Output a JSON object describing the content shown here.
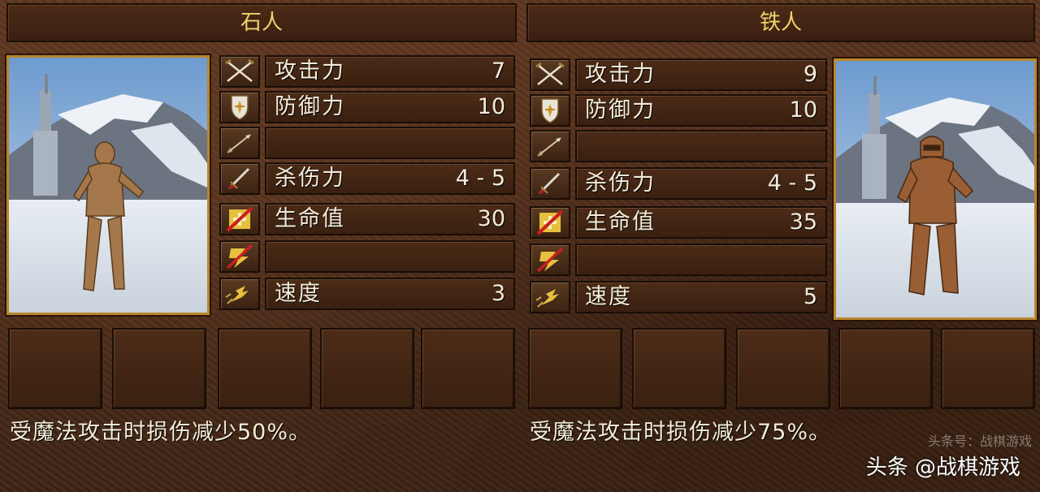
{
  "units": [
    {
      "name": "石人",
      "stats": [
        {
          "icon": "crossed-swords-icon",
          "label": "攻击力",
          "value": "7"
        },
        {
          "icon": "shield-icon",
          "label": "防御力",
          "value": "10"
        },
        {
          "icon": "arrow-icon",
          "label": "",
          "value": ""
        },
        {
          "icon": "sword-icon",
          "label": "杀伤力",
          "value": "4 - 5"
        },
        {
          "icon": "health-icon",
          "label": "生命值",
          "value": "30"
        },
        {
          "icon": "mana-icon",
          "label": "",
          "value": ""
        },
        {
          "icon": "speed-icon",
          "label": "速度",
          "value": "3"
        }
      ],
      "description": "受魔法攻击时损伤减少50%。"
    },
    {
      "name": "铁人",
      "stats": [
        {
          "icon": "crossed-swords-icon",
          "label": "攻击力",
          "value": "9"
        },
        {
          "icon": "shield-icon",
          "label": "防御力",
          "value": "10"
        },
        {
          "icon": "arrow-icon",
          "label": "",
          "value": ""
        },
        {
          "icon": "sword-icon",
          "label": "杀伤力",
          "value": "4 - 5"
        },
        {
          "icon": "health-icon",
          "label": "生命值",
          "value": "35"
        },
        {
          "icon": "mana-icon",
          "label": "",
          "value": ""
        },
        {
          "icon": "speed-icon",
          "label": "速度",
          "value": "5"
        }
      ],
      "description": "受魔法攻击时损伤减少75%。"
    }
  ],
  "watermark": {
    "small": "头条号：战棋游戏",
    "large": "头条 @战棋游戏"
  },
  "colors": {
    "title_text": "#f2d26a",
    "body_text": "#f4ecd8",
    "portrait_frame": "#b8872c"
  }
}
